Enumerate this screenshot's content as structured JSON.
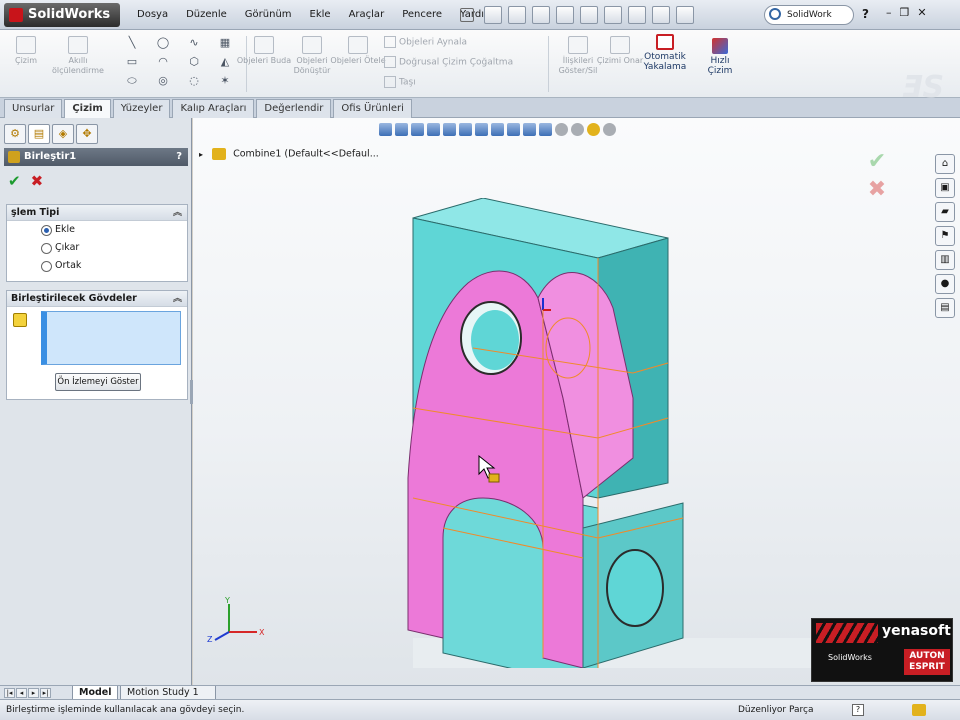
{
  "app": {
    "title": "SolidWorks"
  },
  "menu": [
    "Dosya",
    "Düzenle",
    "Görünüm",
    "Ekle",
    "Araçlar",
    "Pencere",
    "Yardım"
  ],
  "search": {
    "value": "SolidWork"
  },
  "window_controls": {
    "help": "?",
    "minimize": "–",
    "restore": "❐",
    "close": "✕"
  },
  "ribbon": {
    "cizim": "Çizim",
    "akilli_olcu": "Akıllı ölçülendirme",
    "obje_buda": "Objeleri Buda",
    "obje_donustur": "Objeleri Dönüştür",
    "obje_otele": "Objeleri Ötele",
    "obje_aynala": "Objeleri Aynala",
    "dogrusal_cogalt": "Doğrusal Çizim Çoğaltma",
    "tasi": "Taşı",
    "iliski": "İlişkileri Göster/Sil",
    "cizimi_onar": "Çizimi Onar",
    "otomatik": "Otomatik Yakalama",
    "hizli": "Hızlı Çizim"
  },
  "tabs": [
    {
      "label": "Unsurlar",
      "active": false
    },
    {
      "label": "Çizim",
      "active": true
    },
    {
      "label": "Yüzeyler",
      "active": false
    },
    {
      "label": "Kalıp Araçları",
      "active": false
    },
    {
      "label": "Değerlendir",
      "active": false
    },
    {
      "label": "Ofis Ürünleri",
      "active": false
    }
  ],
  "property_manager": {
    "title": "Birleştir1",
    "help": "?",
    "ok": "✔",
    "cancel": "✖",
    "operation_group": {
      "title": "şlem Tipi",
      "options": [
        {
          "label": "Ekle",
          "selected": true
        },
        {
          "label": "Çıkar",
          "selected": false
        },
        {
          "label": "Ortak",
          "selected": false
        }
      ]
    },
    "bodies_group": {
      "title": "Birleştirilecek Gövdeler",
      "preview_button": "Ön İzlemeyi Göster"
    }
  },
  "feature_tree": {
    "label": "Combine1  (Default<<Defaul..."
  },
  "triad": {
    "x": "X",
    "y": "Y",
    "z": "Z"
  },
  "watermark": {
    "brand": "yenasoft",
    "partner_1": "SolidWorks",
    "partner_2": "AUTON",
    "partner_3": "ESPRIT"
  },
  "bottom_tabs": [
    "Model",
    "Motion Study 1"
  ],
  "nav_arrows": [
    "|◂",
    "◂",
    "▸",
    "▸|"
  ],
  "status": {
    "message": "Birleştirme işleminde kullanılacak ana gövdeyi seçin.",
    "mode": "Düzenliyor Parça",
    "help_icon": "?"
  },
  "colors": {
    "body_cyan": "#5fd6d6",
    "body_pink": "#ec79d8",
    "edge_orange": "#f08a2a",
    "accent_red": "#c81e24"
  }
}
